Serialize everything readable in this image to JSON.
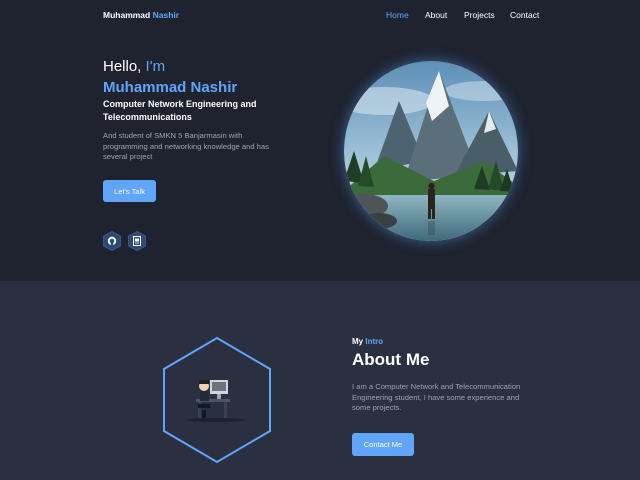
{
  "nav": {
    "brand_first": "Muhammad",
    "brand_second": "Nashir",
    "links": [
      "Home",
      "About",
      "Projects",
      "Contact"
    ],
    "active_link": "Home"
  },
  "hero": {
    "greeting": "Hello,",
    "greeting_accent": "I'm",
    "name": "Muhammad Nashir",
    "role": "Computer Network Engineering and Telecommunications",
    "description": "And student of SMKN 5 Banjarmasin with programming and networking knowledge and has several project",
    "cta_label": "Let's Talk",
    "social": [
      {
        "icon": "github-icon"
      },
      {
        "icon": "document-icon"
      }
    ]
  },
  "about": {
    "subtitle_first": "My",
    "subtitle_accent": "Intro",
    "title": "About Me",
    "description": "I am a Computer Network and Telecommunication Engineering student, I have some experience and some projects.",
    "cta_label": "Contact Me"
  },
  "colors": {
    "accent": "#60a5fa",
    "hero_bg": "#1f2330",
    "section_bg": "#2a3040",
    "muted_text": "#9ca3af"
  }
}
